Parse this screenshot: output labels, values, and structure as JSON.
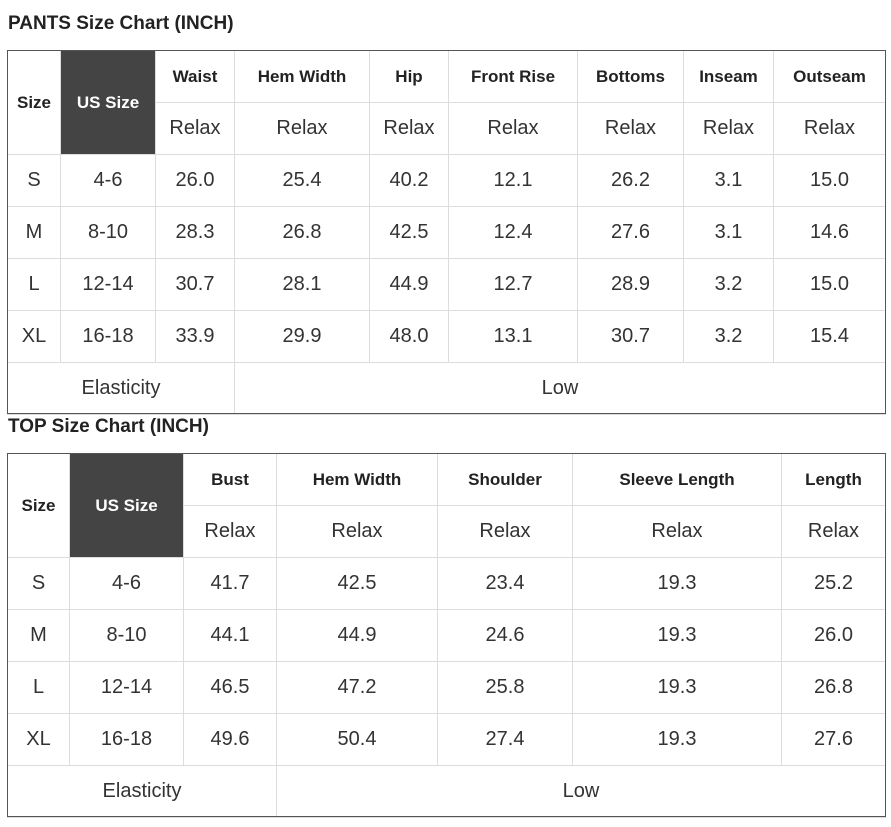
{
  "pants": {
    "title": "PANTS Size Chart (INCH)",
    "size_header": "Size",
    "us_size_header": "US Size",
    "columns": [
      "Waist",
      "Hem Width",
      "Hip",
      "Front Rise",
      "Bottoms",
      "Inseam",
      "Outseam"
    ],
    "sublabel": [
      "Relax",
      "Relax",
      "Relax",
      "Relax",
      "Relax",
      "Relax",
      "Relax"
    ],
    "rows": [
      {
        "size": "S",
        "us": "4-6",
        "values": [
          "26.0",
          "25.4",
          "40.2",
          "12.1",
          "26.2",
          "3.1",
          "15.0"
        ]
      },
      {
        "size": "M",
        "us": "8-10",
        "values": [
          "28.3",
          "26.8",
          "42.5",
          "12.4",
          "27.6",
          "3.1",
          "14.6"
        ]
      },
      {
        "size": "L",
        "us": "12-14",
        "values": [
          "30.7",
          "28.1",
          "44.9",
          "12.7",
          "28.9",
          "3.2",
          "15.0"
        ]
      },
      {
        "size": "XL",
        "us": "16-18",
        "values": [
          "33.9",
          "29.9",
          "48.0",
          "13.1",
          "30.7",
          "3.2",
          "15.4"
        ]
      }
    ],
    "elasticity_label": "Elasticity",
    "elasticity_value": "Low"
  },
  "top": {
    "title": "TOP Size Chart (INCH)",
    "size_header": "Size",
    "us_size_header": "US Size",
    "columns": [
      "Bust",
      "Hem Width",
      "Shoulder",
      "Sleeve Length",
      "Length"
    ],
    "sublabel": [
      "Relax",
      "Relax",
      "Relax",
      "Relax",
      "Relax"
    ],
    "rows": [
      {
        "size": "S",
        "us": "4-6",
        "values": [
          "41.7",
          "42.5",
          "23.4",
          "19.3",
          "25.2"
        ]
      },
      {
        "size": "M",
        "us": "8-10",
        "values": [
          "44.1",
          "44.9",
          "24.6",
          "19.3",
          "26.0"
        ]
      },
      {
        "size": "L",
        "us": "12-14",
        "values": [
          "46.5",
          "47.2",
          "25.8",
          "19.3",
          "26.8"
        ]
      },
      {
        "size": "XL",
        "us": "16-18",
        "values": [
          "49.6",
          "50.4",
          "27.4",
          "19.3",
          "27.6"
        ]
      }
    ],
    "elasticity_label": "Elasticity",
    "elasticity_value": "Low"
  }
}
